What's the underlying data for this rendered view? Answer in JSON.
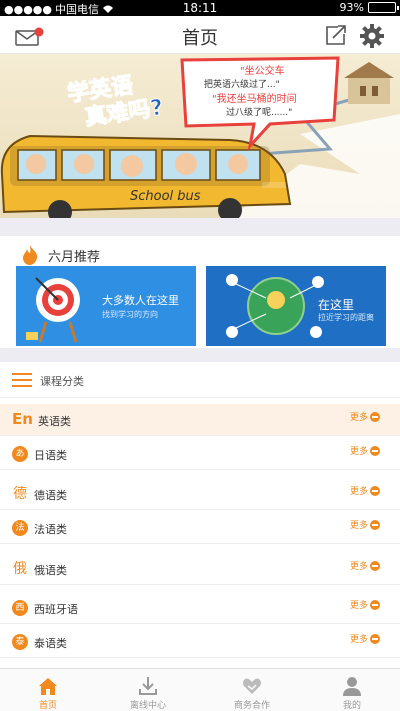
{
  "status": {
    "carrier": "中国电信",
    "time": "18:11",
    "battery": "93%",
    "battery_level": 0.93
  },
  "nav": {
    "title": "首页"
  },
  "banner": {
    "title_line1": "学英语",
    "title_line2": "真难吗?",
    "bubble_line1": "\"坐公交车",
    "bubble_line2": "把英语六级过了...\"",
    "bubble_line3": "\"我还坐马桶的时间",
    "bubble_line4": "过八级了呢......\"",
    "bus_text": "School bus"
  },
  "recommend": {
    "title": "六月推荐",
    "card1": {
      "line1": "大多数人在这里",
      "line2": "找到学习的方向"
    },
    "card2": {
      "line1": "在这里",
      "line2": "拉近学习的距离"
    }
  },
  "category": {
    "title": "课程分类",
    "more_label": "更多",
    "items": [
      {
        "icon": "En",
        "name": "英语类",
        "active": true
      },
      {
        "icon": "あ",
        "name": "日语类"
      },
      {
        "icon": "德",
        "name": "德语类"
      },
      {
        "icon": "法",
        "name": "法语类"
      },
      {
        "icon": "俄",
        "name": "俄语类"
      },
      {
        "icon": "西",
        "name": "西班牙语"
      },
      {
        "icon": "泰",
        "name": "泰语类"
      }
    ]
  },
  "tabs": [
    {
      "label": "首页",
      "icon": "home-icon",
      "active": true
    },
    {
      "label": "离线中心",
      "icon": "download-icon"
    },
    {
      "label": "商务合作",
      "icon": "handshake-icon"
    },
    {
      "label": "我的",
      "icon": "user-icon"
    }
  ],
  "colors": {
    "accent": "#f08a1e",
    "card1": "#2f8fe2",
    "card2": "#1f6fc4"
  }
}
